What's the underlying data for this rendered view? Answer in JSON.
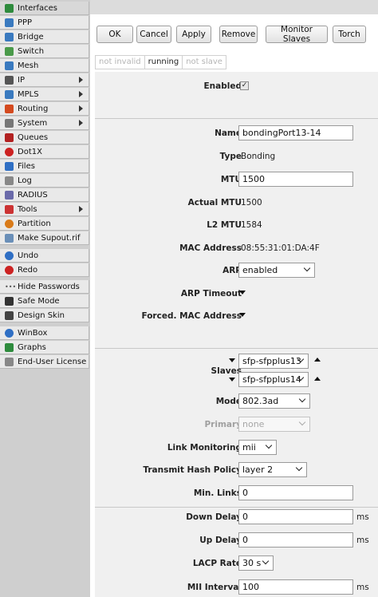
{
  "sidebar": {
    "items": [
      {
        "label": "Interfaces",
        "icon": "interfaces-icon",
        "color": "#2e8b3d"
      },
      {
        "label": "PPP",
        "icon": "ppp-icon",
        "color": "#3a7abf"
      },
      {
        "label": "Bridge",
        "icon": "bridge-icon",
        "color": "#3a7abf"
      },
      {
        "label": "Switch",
        "icon": "switch-icon",
        "color": "#4a9a4a"
      },
      {
        "label": "Mesh",
        "icon": "mesh-icon",
        "color": "#3a7abf"
      },
      {
        "label": "IP",
        "icon": "ip-icon",
        "color": "#555555"
      },
      {
        "label": "MPLS",
        "icon": "mpls-icon",
        "color": "#3a7abf"
      },
      {
        "label": "Routing",
        "icon": "routing-icon",
        "color": "#d44a1f"
      },
      {
        "label": "System",
        "icon": "system-icon",
        "color": "#777777"
      },
      {
        "label": "Queues",
        "icon": "queues-icon",
        "color": "#b22222"
      },
      {
        "label": "Dot1X",
        "icon": "dot1x-icon",
        "color": "#cc2222"
      },
      {
        "label": "Files",
        "icon": "files-icon",
        "color": "#2f6fc4"
      },
      {
        "label": "Log",
        "icon": "log-icon",
        "color": "#888888"
      },
      {
        "label": "RADIUS",
        "icon": "radius-icon",
        "color": "#6a6aaa"
      },
      {
        "label": "Tools",
        "icon": "tools-icon",
        "color": "#cc3333"
      },
      {
        "label": "Partition",
        "icon": "partition-icon",
        "color": "#d97b1a"
      },
      {
        "label": "Make Supout.rif",
        "icon": "supout-icon",
        "color": "#6a8fb8"
      },
      {
        "label": "Undo",
        "icon": "undo-icon",
        "color": "#2f6fc4"
      },
      {
        "label": "Redo",
        "icon": "redo-icon",
        "color": "#cc2222"
      },
      {
        "label": "Hide Passwords",
        "icon": "dots-icon",
        "color": "#555555"
      },
      {
        "label": "Safe Mode",
        "icon": "safe-mode-icon",
        "color": "#333333"
      },
      {
        "label": "Design Skin",
        "icon": "design-skin-icon",
        "color": "#444444"
      },
      {
        "label": "WinBox",
        "icon": "winbox-icon",
        "color": "#2f6fc4"
      },
      {
        "label": "Graphs",
        "icon": "graphs-icon",
        "color": "#2e8b3d"
      },
      {
        "label": "End-User License",
        "icon": "license-icon",
        "color": "#888888"
      }
    ]
  },
  "toolbar": {
    "ok": "OK",
    "cancel": "Cancel",
    "apply": "Apply",
    "remove": "Remove",
    "monitor_slaves": "Monitor Slaves",
    "torch": "Torch"
  },
  "status": {
    "invalid": "not invalid",
    "running": "running",
    "slave": "not slave"
  },
  "form": {
    "enabled_label": "Enabled",
    "enabled_mark": "✓",
    "name_label": "Name",
    "name_value": "bondingPort13-14",
    "type_label": "Type",
    "type_value": "Bonding",
    "mtu_label": "MTU",
    "mtu_value": "1500",
    "actual_mtu_label": "Actual MTU",
    "actual_mtu_value": "1500",
    "l2mtu_label": "L2 MTU",
    "l2mtu_value": "1584",
    "mac_label": "MAC Address",
    "mac_value": "08:55:31:01:DA:4F",
    "arp_label": "ARP",
    "arp_value": "enabled",
    "arp_timeout_label": "ARP Timeout",
    "forced_mac_label": "Forced. MAC Address",
    "slaves_label": "Slaves",
    "slave1": "sfp-sfpplus13",
    "slave2": "sfp-sfpplus14",
    "mode_label": "Mode",
    "mode_value": "802.3ad",
    "primary_label": "Primary",
    "primary_value": "none",
    "link_monitoring_label": "Link Monitoring",
    "link_monitoring_value": "mii",
    "hash_label": "Transmit Hash Policy",
    "hash_value": "layer 2",
    "min_links_label": "Min. Links",
    "min_links_value": "0",
    "down_delay_label": "Down Delay",
    "down_delay_value": "0",
    "down_delay_unit": "ms",
    "up_delay_label": "Up Delay",
    "up_delay_value": "0",
    "up_delay_unit": "ms",
    "lacp_label": "LACP Rate",
    "lacp_value": "30 s",
    "mii_label": "MII Interval",
    "mii_value": "100",
    "mii_unit": "ms"
  }
}
